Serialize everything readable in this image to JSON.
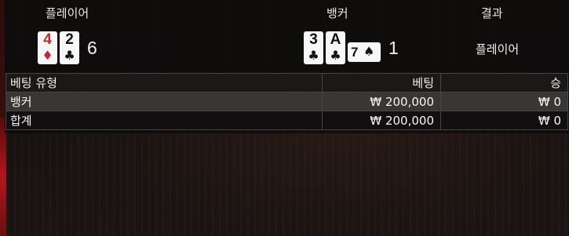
{
  "header": {
    "player": "플레이어",
    "banker": "뱅커",
    "result": "결과"
  },
  "colors": {
    "red_suit": "#d2232a",
    "black_suit": "#111111"
  },
  "player": {
    "cards": [
      {
        "rank": "4",
        "suit": "♦",
        "suit_name": "diamond-icon",
        "color": "red"
      },
      {
        "rank": "2",
        "suit": "♣",
        "suit_name": "club-icon",
        "color": "black"
      }
    ],
    "score": "6"
  },
  "banker": {
    "cards": [
      {
        "rank": "3",
        "suit": "♣",
        "suit_name": "club-icon",
        "color": "black"
      },
      {
        "rank": "A",
        "suit": "♣",
        "suit_name": "club-icon",
        "color": "black"
      },
      {
        "rank": "7",
        "suit": "♠",
        "suit_name": "spade-icon",
        "color": "black",
        "sideways": true
      }
    ],
    "score": "1"
  },
  "result_text": "플레이어",
  "bets_table": {
    "headers": [
      "베팅 유형",
      "베팅",
      "승"
    ],
    "rows": [
      [
        "뱅커",
        "₩ 200,000",
        "₩ 0"
      ],
      [
        "합계",
        "₩ 200,000",
        "₩ 0"
      ]
    ]
  }
}
